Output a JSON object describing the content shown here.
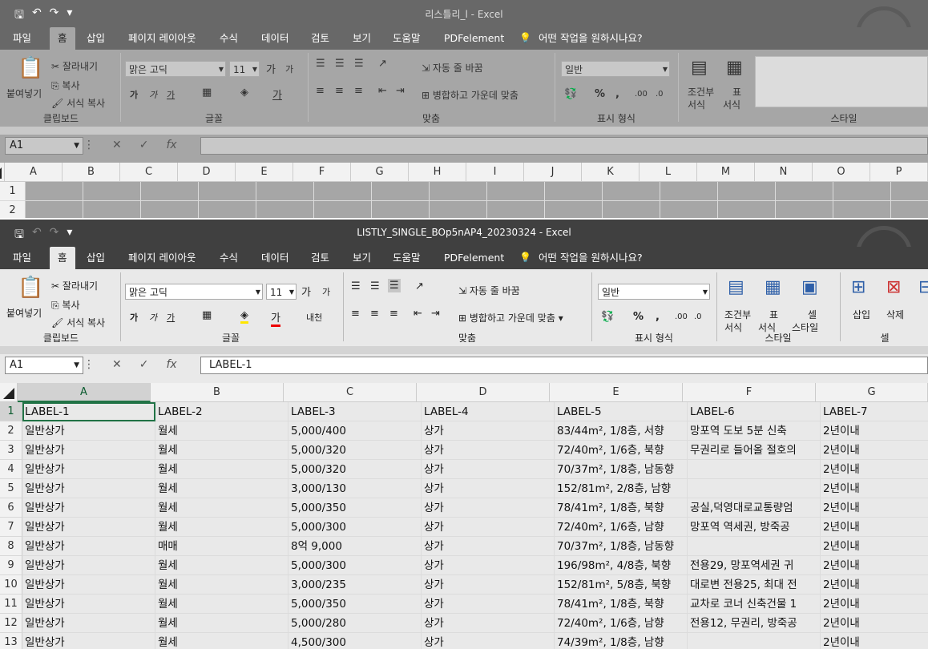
{
  "colors": {
    "win1_title_bg": "#686868",
    "win1_ribbon_bg": "#a6a6a6",
    "win2_title_bg": "#404040",
    "win2_ribbon_bg": "#e9e9e9",
    "accent": "#217346"
  },
  "win1": {
    "title": "리스틀리_l  -  Excel",
    "tabs": [
      "파일",
      "홈",
      "삽입",
      "페이지 레이아웃",
      "수식",
      "데이터",
      "검토",
      "보기",
      "도움말",
      "PDFelement",
      "어떤 작업을 원하시나요?"
    ],
    "ribbon": {
      "paste": "붙여넣기",
      "cut": "잘라내기",
      "copy": "복사",
      "format_painter": "서식 복사",
      "clipboard": "클립보드",
      "font_name": "맑은 고딕",
      "font_size": "11",
      "font_group": "글꼴",
      "wrap": "자동 줄 바꿈",
      "merge": "병합하고 가운데 맞춤",
      "align_group": "맞춤",
      "number_format": "일반",
      "number_group": "표시 형식",
      "cond_format_1": "조건부",
      "cond_format_2": "서식",
      "table_1": "표",
      "table_2": "서식",
      "styles_group": "스타일"
    },
    "namebox": "A1",
    "formula": "",
    "columns": [
      "A",
      "B",
      "C",
      "D",
      "E",
      "F",
      "G",
      "H",
      "I",
      "J",
      "K",
      "L",
      "M",
      "N",
      "O",
      "P"
    ],
    "rows": [
      "1",
      "2"
    ]
  },
  "win2": {
    "title": "LISTLY_SINGLE_BOp5nAP4_20230324  -  Excel",
    "tabs": [
      "파일",
      "홈",
      "삽입",
      "페이지 레이아웃",
      "수식",
      "데이터",
      "검토",
      "보기",
      "도움말",
      "PDFelement",
      "어떤 작업을 원하시나요?"
    ],
    "ribbon": {
      "paste": "붙여넣기",
      "cut": "잘라내기",
      "copy": "복사",
      "format_painter": "서식 복사",
      "clipboard": "클립보드",
      "font_name": "맑은 고딕",
      "font_size": "11",
      "font_group": "글꼴",
      "phonetic": "내천",
      "wrap": "자동 줄 바꿈",
      "merge": "병합하고 가운데 맞춤",
      "align_group": "맞춤",
      "number_format": "일반",
      "number_group": "표시 형식",
      "cond_format_1": "조건부",
      "cond_format_2": "서식",
      "table_1": "표",
      "table_2": "서식",
      "cell_style_1": "셀",
      "cell_style_2": "스타일",
      "styles_group": "스타일",
      "insert": "삽입",
      "delete": "삭제",
      "cells_group": "셀"
    },
    "namebox": "A1",
    "formula": "LABEL-1",
    "columns": [
      "A",
      "B",
      "C",
      "D",
      "E",
      "F",
      "G"
    ],
    "rows": [
      [
        "1",
        "LABEL-1",
        "LABEL-2",
        "LABEL-3",
        "LABEL-4",
        "LABEL-5",
        "LABEL-6",
        "LABEL-7"
      ],
      [
        "2",
        "일반상가",
        "월세",
        "5,000/400",
        "상가",
        "83/44m², 1/8층, 서향",
        "망포역 도보 5분 신축",
        "2년이내"
      ],
      [
        "3",
        "일반상가",
        "월세",
        "5,000/320",
        "상가",
        "72/40m², 1/6층, 북향",
        "무권리로 들어올 절호의",
        "2년이내"
      ],
      [
        "4",
        "일반상가",
        "월세",
        "5,000/320",
        "상가",
        "70/37m², 1/8층, 남동향",
        "",
        "2년이내"
      ],
      [
        "5",
        "일반상가",
        "월세",
        "3,000/130",
        "상가",
        "152/81m², 2/8층, 남향",
        "",
        "2년이내"
      ],
      [
        "6",
        "일반상가",
        "월세",
        "5,000/350",
        "상가",
        "78/41m², 1/8층, 북향",
        "공실,덕영대로교통량엄",
        "2년이내"
      ],
      [
        "7",
        "일반상가",
        "월세",
        "5,000/300",
        "상가",
        "72/40m², 1/6층, 남향",
        "망포역 역세권, 방죽공",
        "2년이내"
      ],
      [
        "8",
        "일반상가",
        "매매",
        "8억 9,000",
        "상가",
        "70/37m², 1/8층, 남동향",
        "",
        "2년이내"
      ],
      [
        "9",
        "일반상가",
        "월세",
        "5,000/300",
        "상가",
        "196/98m², 4/8층, 북향",
        "전용29, 망포역세권 귀",
        "2년이내"
      ],
      [
        "10",
        "일반상가",
        "월세",
        "3,000/235",
        "상가",
        "152/81m², 5/8층, 북향",
        "대로변 전용25, 최대 전",
        "2년이내"
      ],
      [
        "11",
        "일반상가",
        "월세",
        "5,000/350",
        "상가",
        "78/41m², 1/8층, 북향",
        "교차로 코너 신축건물 1",
        "2년이내"
      ],
      [
        "12",
        "일반상가",
        "월세",
        "5,000/280",
        "상가",
        "72/40m², 1/6층, 남향",
        "전용12, 무권리, 방죽공",
        "2년이내"
      ],
      [
        "13",
        "일반상가",
        "월세",
        "4,500/300",
        "상가",
        "74/39m², 1/8층, 남향",
        "",
        "2년이내"
      ]
    ]
  }
}
